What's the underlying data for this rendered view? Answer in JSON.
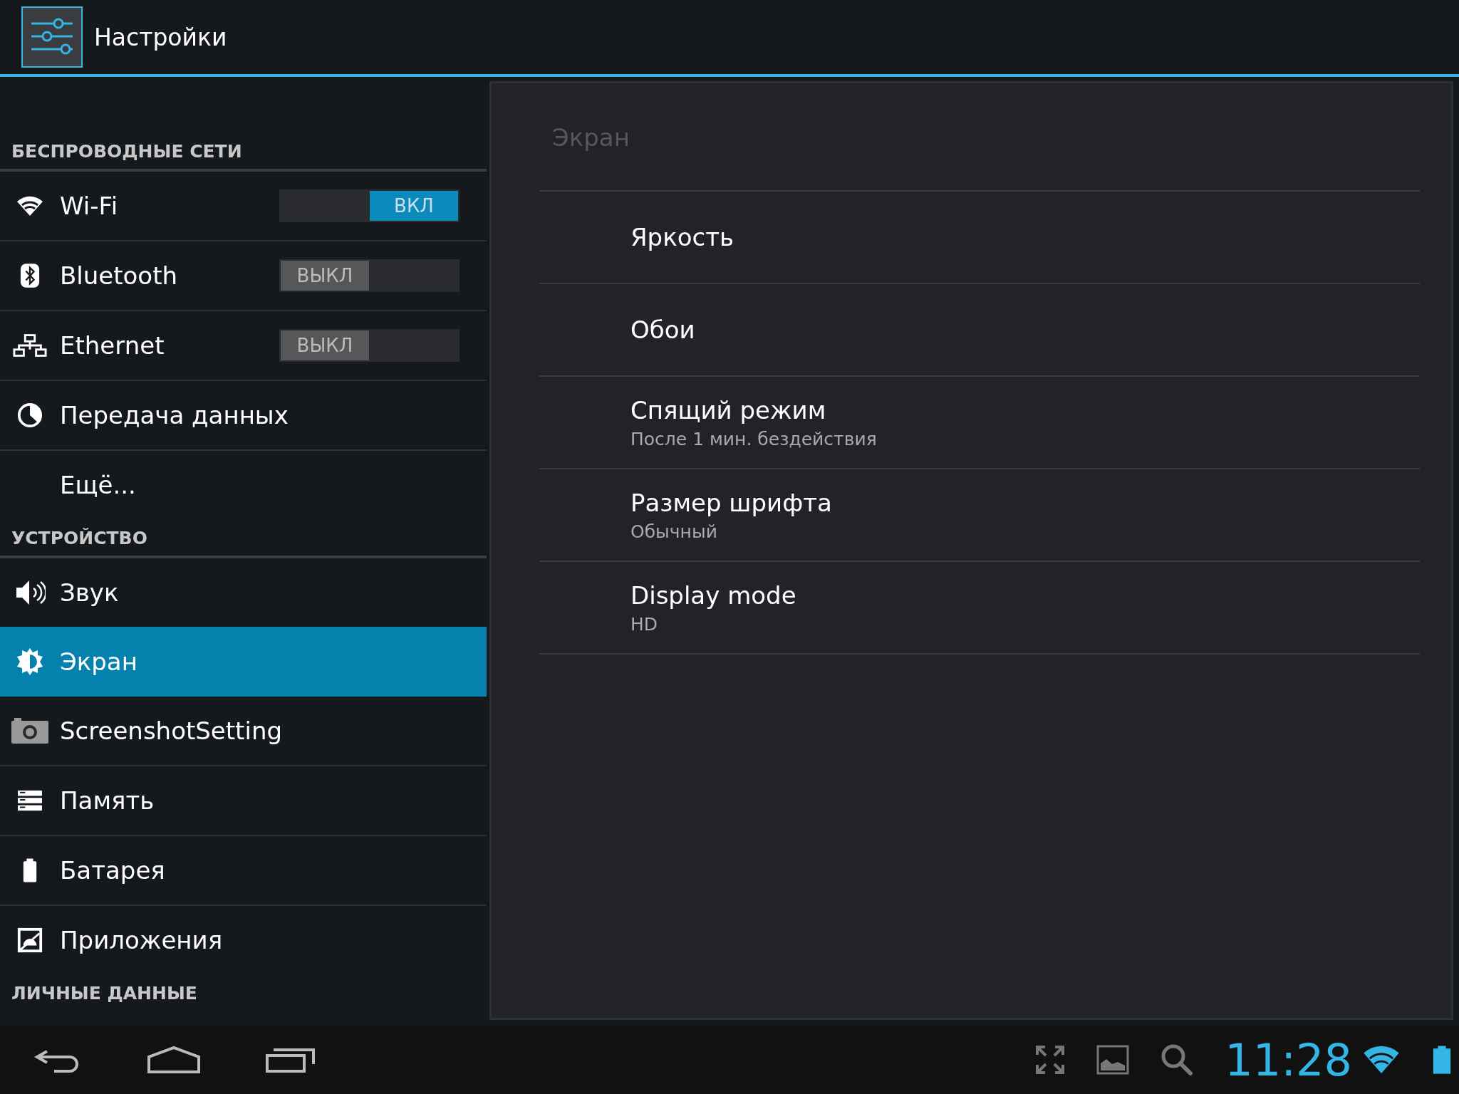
{
  "action_bar": {
    "title": "Настройки"
  },
  "sidebar": {
    "sections": [
      {
        "header": "БЕСПРОВОДНЫЕ СЕТИ",
        "items": [
          {
            "label": "Wi-Fi",
            "selected": false,
            "toggle": {
              "on": true,
              "label": "ВКЛ"
            }
          },
          {
            "label": "Bluetooth",
            "selected": false,
            "toggle": {
              "on": false,
              "label": "ВЫКЛ"
            }
          },
          {
            "label": "Ethernet",
            "selected": false,
            "toggle": {
              "on": false,
              "label": "ВЫКЛ"
            }
          },
          {
            "label": "Передача данных",
            "selected": false
          },
          {
            "label": "Ещё...",
            "selected": false
          }
        ]
      },
      {
        "header": "УСТРОЙСТВО",
        "items": [
          {
            "label": "Звук",
            "selected": false
          },
          {
            "label": "Экран",
            "selected": true
          },
          {
            "label": "ScreenshotSetting",
            "selected": false
          },
          {
            "label": "Память",
            "selected": false
          },
          {
            "label": "Батарея",
            "selected": false
          },
          {
            "label": "Приложения",
            "selected": false
          }
        ]
      },
      {
        "header": "ЛИЧНЫЕ ДАННЫЕ"
      }
    ]
  },
  "detail": {
    "title": "Экран",
    "items": [
      {
        "title": "Яркость"
      },
      {
        "title": "Обои"
      },
      {
        "title": "Спящий режим",
        "summary": "После 1 мин. бездействия"
      },
      {
        "title": "Размер шрифта",
        "summary": "Обычный"
      },
      {
        "title": "Display mode",
        "summary": "HD"
      }
    ]
  },
  "status_bar": {
    "time": "11:28"
  }
}
